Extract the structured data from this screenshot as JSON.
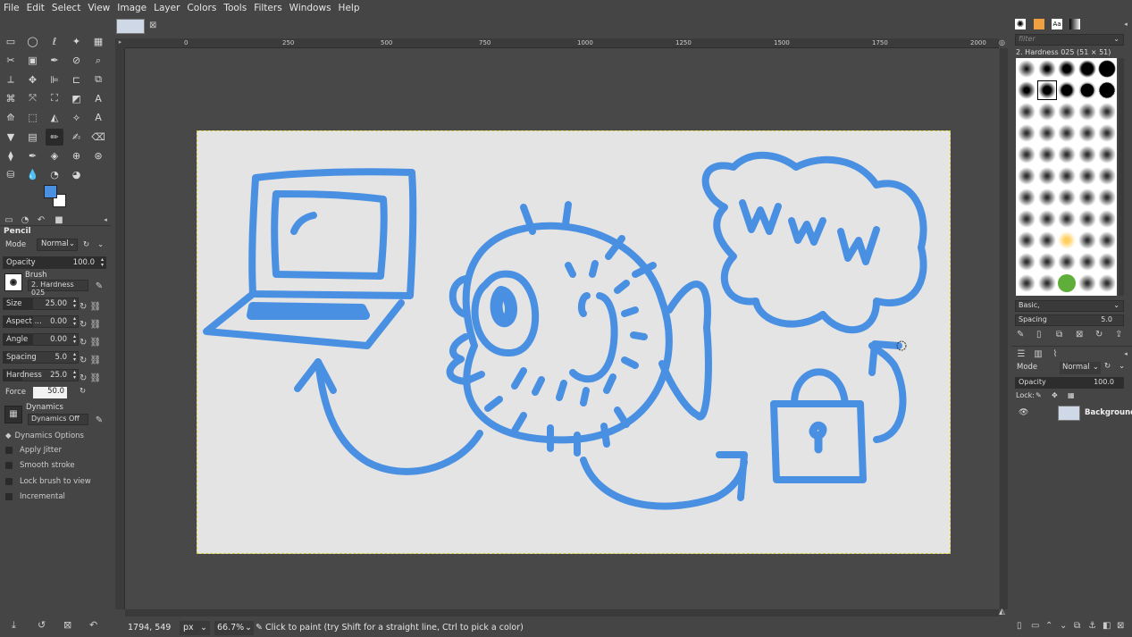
{
  "menu": [
    "File",
    "Edit",
    "Select",
    "View",
    "Image",
    "Layer",
    "Colors",
    "Tools",
    "Filters",
    "Windows",
    "Help"
  ],
  "colors": {
    "fg": "#4a90e2",
    "bg": "#ffffff",
    "stroke": "#4a90e2",
    "canvas": "#e4e4e4"
  },
  "tool_options": {
    "title": "Pencil",
    "mode_label": "Mode",
    "mode_value": "Normal",
    "opacity_label": "Opacity",
    "opacity_value": "100.0",
    "brush_label": "Brush",
    "brush_name": "2. Hardness 025",
    "size_label": "Size",
    "size_value": "25.00",
    "aspect_label": "Aspect ...",
    "aspect_value": "0.00",
    "angle_label": "Angle",
    "angle_value": "0.00",
    "spacing_label": "Spacing",
    "spacing_value": "5.0",
    "hardness_label": "Hardness",
    "hardness_value": "25.0",
    "force_label": "Force",
    "force_value": "50.0",
    "dynamics_label": "Dynamics",
    "dynamics_value": "Dynamics Off",
    "dynamics_options": "Dynamics Options",
    "apply_jitter": "Apply Jitter",
    "smooth_stroke": "Smooth stroke",
    "lock_brush": "Lock brush to view",
    "incremental": "Incremental"
  },
  "ruler": {
    "h": [
      "0",
      "250",
      "500",
      "750",
      "1000",
      "1250",
      "1500",
      "1750",
      "2000"
    ]
  },
  "status": {
    "coords": "1794, 549",
    "unit": "px",
    "zoom": "66.7%",
    "message": "Click to paint (try Shift for a straight line, Ctrl to pick a color)"
  },
  "brushes_panel": {
    "filter_placeholder": "filter",
    "title": "2. Hardness 025 (51 × 51)",
    "preset": "Basic,",
    "spacing_label": "Spacing",
    "spacing_value": "5.0"
  },
  "layers_panel": {
    "mode_label": "Mode",
    "mode_value": "Normal",
    "opacity_label": "Opacity",
    "opacity_value": "100.0",
    "lock_label": "Lock:",
    "layer_name": "Background"
  }
}
